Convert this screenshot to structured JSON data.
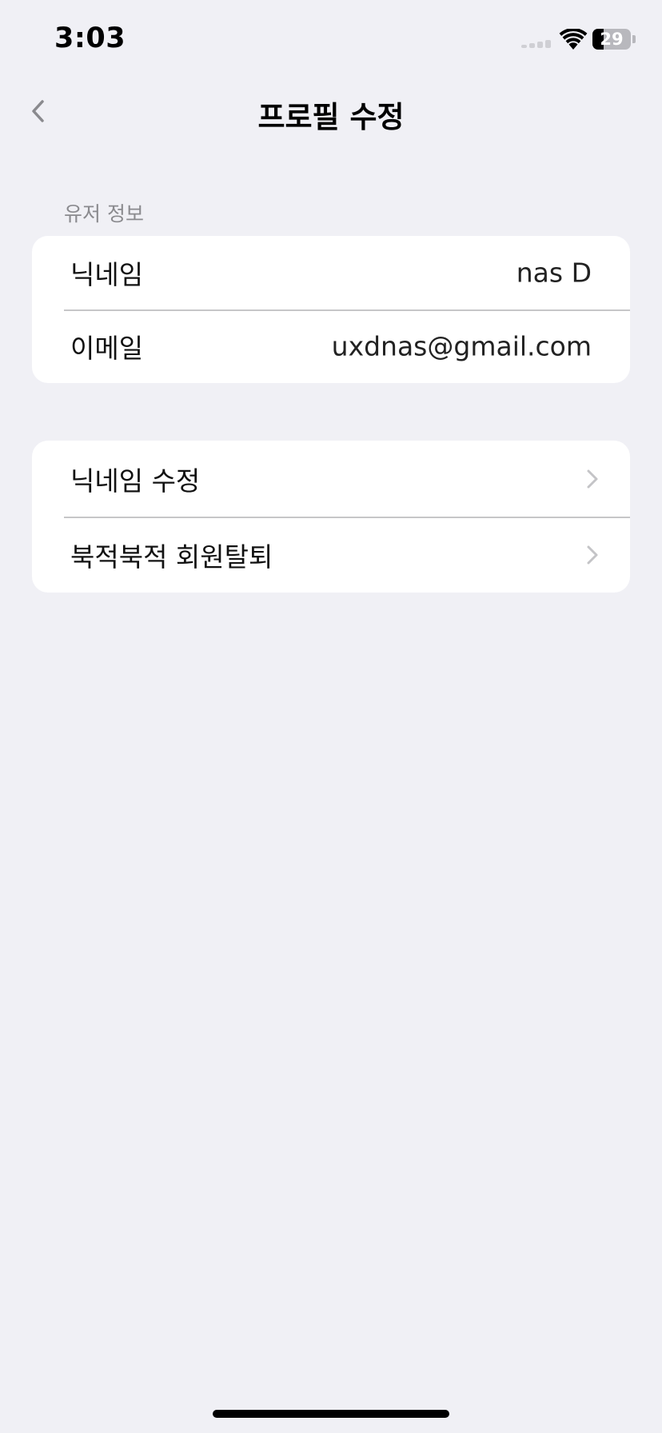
{
  "status_bar": {
    "time": "3:03",
    "battery_level": "29",
    "battery_fraction": 0.29
  },
  "nav": {
    "title": "프로필 수정",
    "back_icon": "chevron-left-icon"
  },
  "user_info": {
    "header": "유저 정보",
    "rows": [
      {
        "label": "닉네임",
        "value": "nas D"
      },
      {
        "label": "이메일",
        "value": "uxdnas@gmail.com"
      }
    ]
  },
  "actions": {
    "rows": [
      {
        "label": "닉네임 수정",
        "icon": "chevron-right-icon"
      },
      {
        "label": "북적북적 회원탈퇴",
        "icon": "chevron-right-icon"
      }
    ]
  },
  "colors": {
    "background": "#f0f0f5",
    "card": "#ffffff",
    "separator": "#c6c6c8",
    "secondary_text": "#8a8a8e",
    "chevron": "#c4c4c7"
  }
}
